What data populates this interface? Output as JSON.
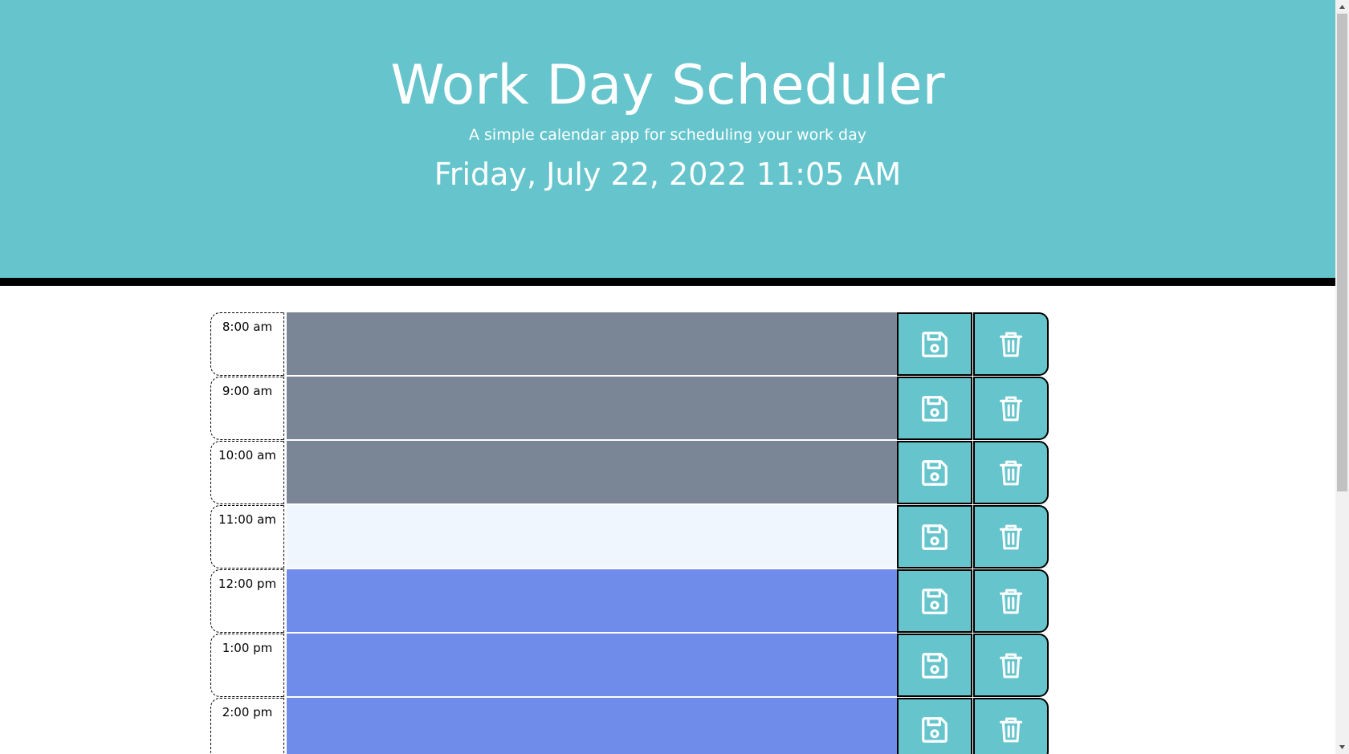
{
  "header": {
    "title": "Work Day Scheduler",
    "subtitle": "A simple calendar app for scheduling your work day",
    "current_datetime": "Friday, July 22, 2022 11:05 AM"
  },
  "colors": {
    "header_bg": "#66c5cc",
    "past": "#7a8696",
    "present": "#eff6fd",
    "future": "#708ceb",
    "button_bg": "#66c5cc"
  },
  "schedule": {
    "rows": [
      {
        "hour": "8:00 am",
        "status": "past",
        "text": ""
      },
      {
        "hour": "9:00 am",
        "status": "past",
        "text": ""
      },
      {
        "hour": "10:00 am",
        "status": "past",
        "text": ""
      },
      {
        "hour": "11:00 am",
        "status": "present",
        "text": ""
      },
      {
        "hour": "12:00 pm",
        "status": "future",
        "text": ""
      },
      {
        "hour": "1:00 pm",
        "status": "future",
        "text": ""
      },
      {
        "hour": "2:00 pm",
        "status": "future",
        "text": ""
      }
    ],
    "save_icon": "floppy-disk-icon",
    "delete_icon": "trash-icon"
  }
}
